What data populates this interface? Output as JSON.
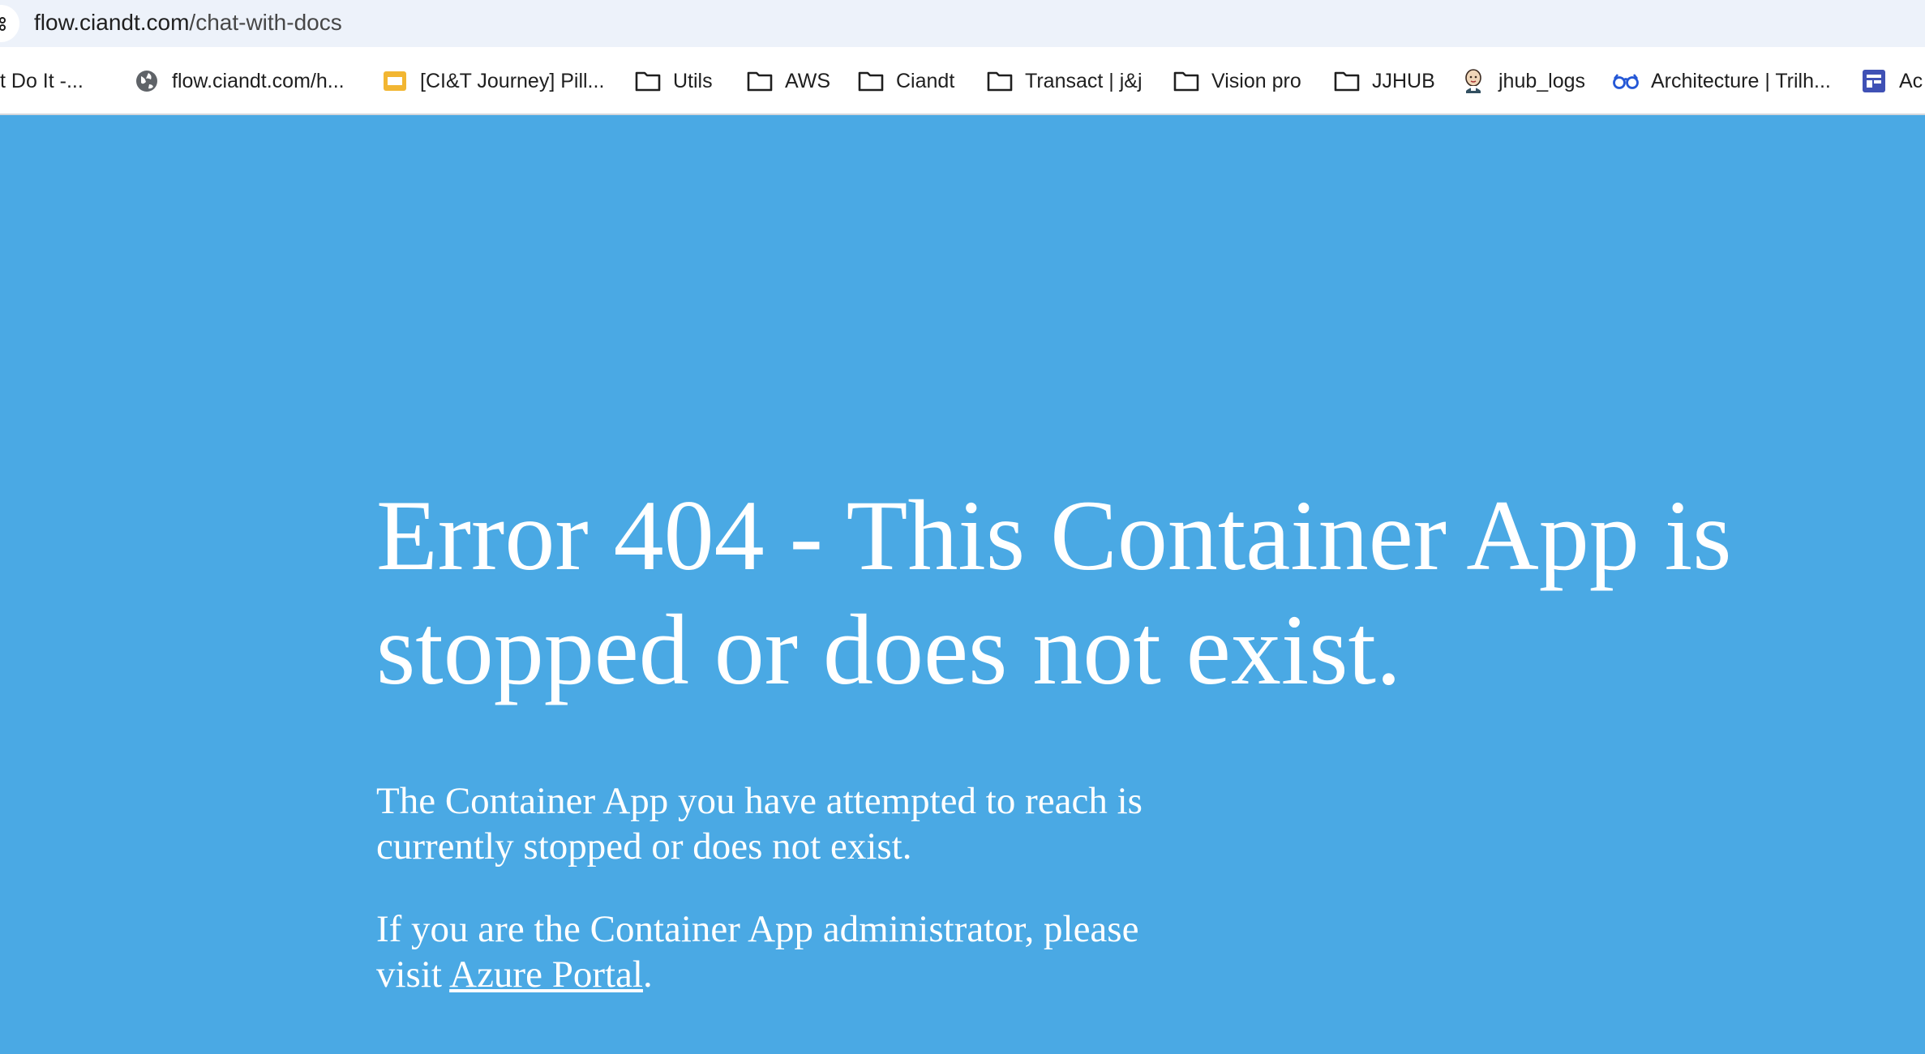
{
  "browser": {
    "url_host": "flow.ciandt.com",
    "url_path": "/chat-with-docs",
    "bookmarks": [
      {
        "label": "t Do It -...",
        "icon": "none"
      },
      {
        "label": "flow.ciandt.com/h...",
        "icon": "globe-icon"
      },
      {
        "label": "[CI&T Journey] Pill...",
        "icon": "slides-icon"
      },
      {
        "label": "Utils",
        "icon": "folder-icon"
      },
      {
        "label": "AWS",
        "icon": "folder-icon"
      },
      {
        "label": "Ciandt",
        "icon": "folder-icon"
      },
      {
        "label": "Transact | j&j",
        "icon": "folder-icon"
      },
      {
        "label": "Vision pro",
        "icon": "folder-icon"
      },
      {
        "label": "JJHUB",
        "icon": "folder-icon"
      },
      {
        "label": "jhub_logs",
        "icon": "jenkins-icon"
      },
      {
        "label": "Architecture | Trilh...",
        "icon": "glasses-icon"
      },
      {
        "label": "Ac",
        "icon": "layout-icon"
      }
    ]
  },
  "page": {
    "heading": "Error 404 - This Container App is stopped or does not exist.",
    "paragraph1": "The Container App you have attempted to reach is currently stopped or does not exist.",
    "paragraph2_prefix": "If you are the Container App administrator, please visit ",
    "portal_link": "Azure Portal",
    "paragraph2_suffix": "."
  },
  "colors": {
    "page_background": "#4aa9e4",
    "text": "#ffffff",
    "address_bar": "#edf2fa"
  }
}
